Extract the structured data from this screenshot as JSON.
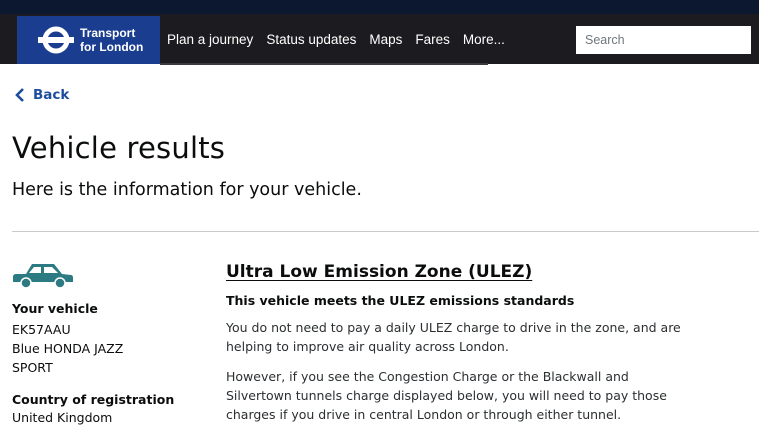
{
  "header": {
    "brand_line1": "Transport",
    "brand_line2": "for London",
    "nav": [
      "Plan a journey",
      "Status updates",
      "Maps",
      "Fares",
      "More..."
    ],
    "search_placeholder": "Search"
  },
  "back_label": "Back",
  "page_title": "Vehicle results",
  "subtitle": "Here is the information for your vehicle.",
  "vehicle": {
    "label": "Your vehicle",
    "reg": "EK57AAU",
    "model_line1": "Blue HONDA JAZZ",
    "model_line2": "SPORT",
    "country_label": "Country of registration",
    "country": "United Kingdom",
    "car_icon_color": "#2c7a82"
  },
  "ulez": {
    "title": "Ultra Low Emission Zone (ULEZ)",
    "status": "This vehicle meets the ULEZ emissions standards",
    "para1": "You do not need to pay a daily ULEZ charge to drive in the zone, and are helping to improve air quality across London.",
    "para2": "However, if you see the Congestion Charge or the Blackwall and Silvertown tunnels charge displayed below, you will need to pay those charges if you drive in central London or through either tunnel."
  }
}
